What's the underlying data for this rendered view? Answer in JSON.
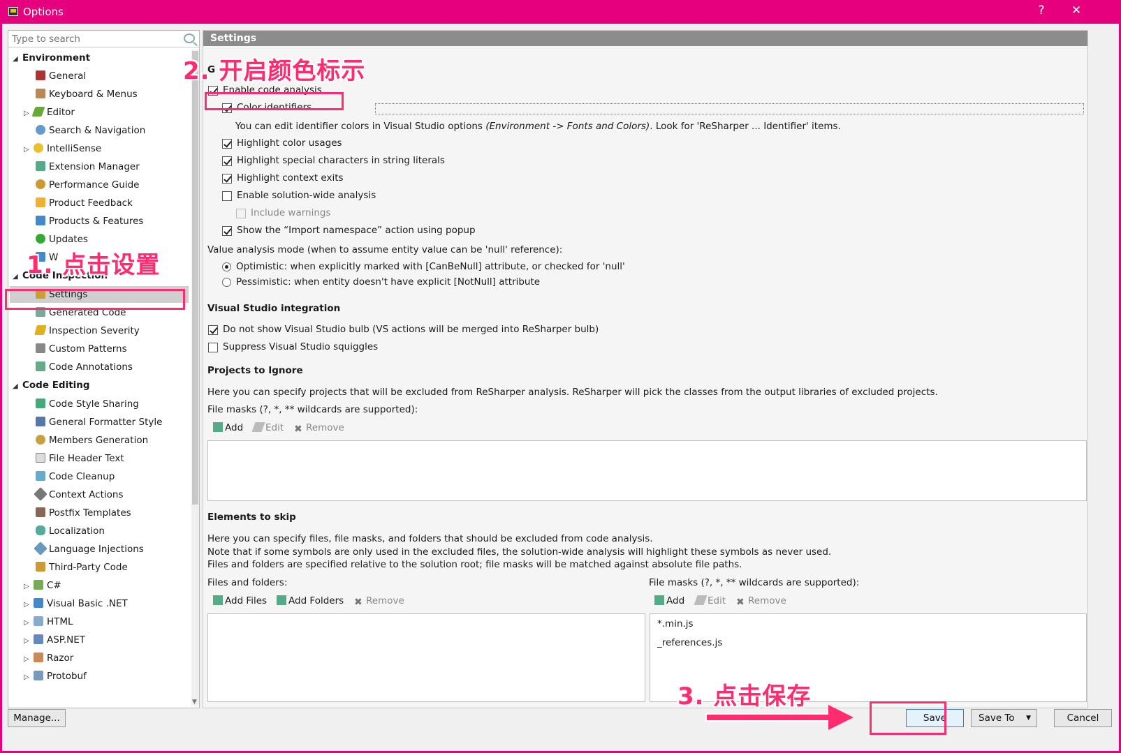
{
  "window": {
    "title": "Options",
    "help": "?",
    "close": "✕"
  },
  "search": {
    "placeholder": "Type to search"
  },
  "tree": {
    "environment": "Environment",
    "general": "General",
    "keyboard_menus": "Keyboard & Menus",
    "editor": "Editor",
    "search_navigation": "Search & Navigation",
    "intellisense": "IntelliSense",
    "extension_manager": "Extension Manager",
    "performance_guide": "Performance Guide",
    "product_feedback": "Product Feedback",
    "products_features": "Products & Features",
    "updates": "Updates",
    "w": "W",
    "code_inspection": "Code Inspection",
    "settings": "Settings",
    "generated_code": "Generated Code",
    "inspection_severity": "Inspection Severity",
    "custom_patterns": "Custom Patterns",
    "code_annotations": "Code Annotations",
    "code_editing": "Code Editing",
    "code_style_sharing": "Code Style Sharing",
    "general_formatter_style": "General Formatter Style",
    "members_generation": "Members Generation",
    "file_header_text": "File Header Text",
    "code_cleanup": "Code Cleanup",
    "context_actions": "Context Actions",
    "postfix_templates": "Postfix Templates",
    "localization": "Localization",
    "language_injections": "Language Injections",
    "third_party_code": "Third-Party Code",
    "csharp": "C#",
    "vbnet": "Visual Basic .NET",
    "html": "HTML",
    "aspnet": "ASP.NET",
    "razor": "Razor",
    "protobuf": "Protobuf"
  },
  "settings": {
    "header": "Settings",
    "general_letter": "G",
    "enable_code_analysis": "Enable code analysis",
    "color_identifiers": "Color identifiers",
    "color_note_a": "You can edit identifier colors in Visual Studio options ",
    "color_note_b": "(Environment -> Fonts and Colors)",
    "color_note_c": ". Look for 'ReSharper ... Identifier' items.",
    "highlight_color_usages": "Highlight color usages",
    "highlight_special_chars": "Highlight special characters in string literals",
    "highlight_context_exits": "Highlight context exits",
    "enable_solution_wide": "Enable solution-wide analysis",
    "include_warnings": "Include warnings",
    "show_import_namespace": "Show the “Import namespace” action using popup",
    "value_analysis_mode": "Value analysis mode (when to assume entity value can be 'null' reference):",
    "optimistic": "Optimistic: when explicitly marked with [CanBeNull] attribute, or checked for 'null'",
    "pessimistic": "Pessimistic: when entity doesn't have explicit [NotNull] attribute",
    "vs_integration": "Visual Studio integration",
    "do_not_show_bulb": "Do not show Visual Studio bulb (VS actions will be merged into ReSharper bulb)",
    "suppress_squiggles": "Suppress Visual Studio squiggles",
    "projects_to_ignore": "Projects to Ignore",
    "projects_desc": "Here you can specify projects that will be excluded from ReSharper analysis. ReSharper will pick the classes from the output libraries of excluded projects.",
    "file_masks_label": "File masks (?, *, ** wildcards are supported):",
    "add": "Add",
    "edit": "Edit",
    "remove": "Remove",
    "elements_to_skip": "Elements to skip",
    "skip_desc_1": "Here you can specify files, file masks, and folders that should be excluded from code analysis.",
    "skip_desc_2": "Note that if some symbols are only used in the excluded files, the solution-wide analysis will highlight these symbols as never used.",
    "skip_desc_3": "Files and folders are specified relative to the solution root; file masks will be matched against absolute file paths.",
    "files_and_folders": "Files and folders:",
    "add_files": "Add Files",
    "add_folders": "Add Folders",
    "file_masks": [
      "*.min.js",
      "_references.js"
    ]
  },
  "bottom": {
    "manage": "Manage...",
    "save": "Save",
    "save_to": "Save To",
    "cancel": "Cancel"
  },
  "annotations": {
    "step1": "1. 点击设置",
    "step2": "2. 开启颜色标示",
    "step3": "3. 点击保存"
  },
  "colors": {
    "titlebar": "#e6007e",
    "annotation": "#ff2d6f"
  }
}
